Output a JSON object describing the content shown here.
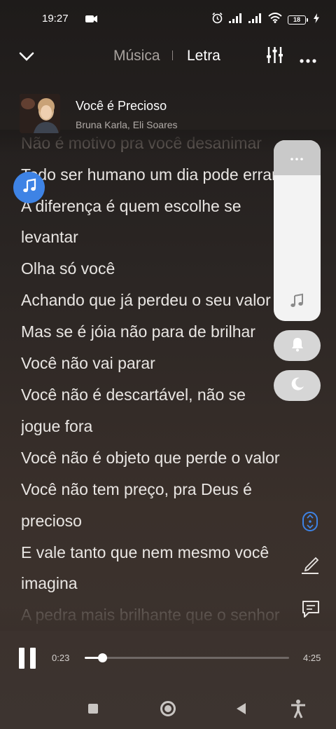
{
  "status_bar": {
    "time": "19:27",
    "battery": "18",
    "icons": [
      "video-camera-icon",
      "alarm-icon",
      "signal-icon",
      "signal-icon",
      "wifi-icon",
      "battery-icon",
      "charging-bolt-icon"
    ]
  },
  "header": {
    "tab_music": "Música",
    "tab_lyrics": "Letra",
    "active_tab": "Letra"
  },
  "song": {
    "title": "Você é Precioso",
    "artist": "Bruna Karla, Eli Soares"
  },
  "lyrics": {
    "lines": [
      "Não é motivo pra você desanimar",
      "Todo ser humano um dia pode errar",
      "A diferença é quem escolhe se",
      "levantar",
      "Olha só você",
      "Achando que já perdeu o seu valor",
      "Mas se é jóia não para de brilhar",
      "Você não vai parar",
      "Você não é descartável, não se",
      "jogue fora",
      "Você não é objeto que perde o valor",
      "Você não tem preço, pra Deus é",
      "precioso",
      "E vale tanto que nem mesmo você",
      "imagina",
      "A pedra mais brilhante que o senhor"
    ]
  },
  "player": {
    "current_time": "0:23",
    "total_time": "4:25",
    "progress": 0.087
  },
  "colors": {
    "accent_blue": "#3e83e5",
    "panel": "#f3f3f3",
    "lyric_text": "#e9e6e3",
    "muted_text": "#a8a29e"
  }
}
